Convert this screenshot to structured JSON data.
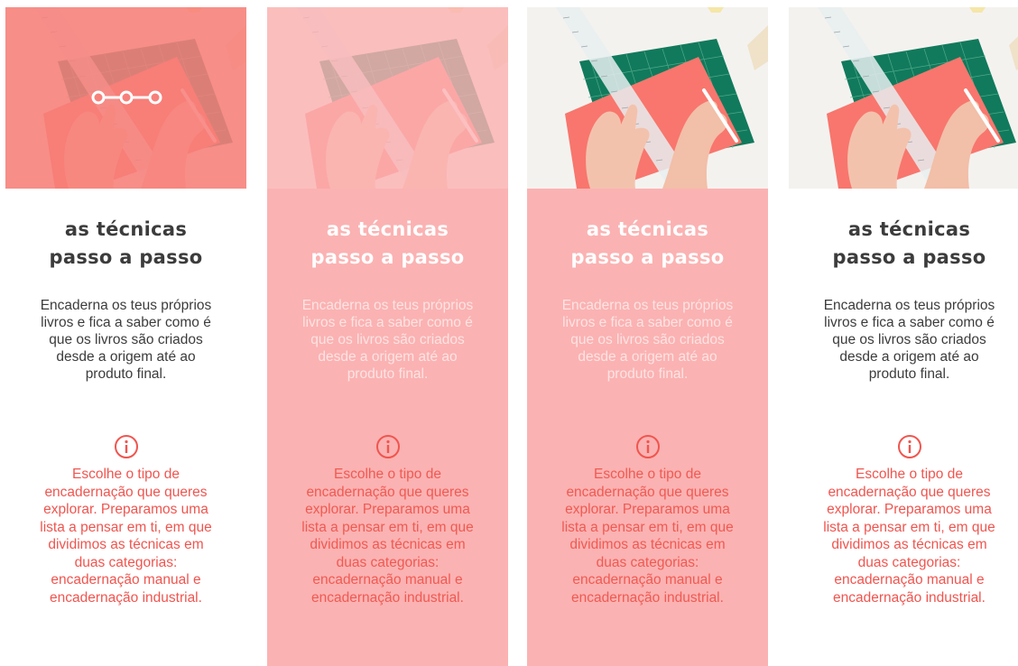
{
  "colors": {
    "accent": "#f0554f",
    "card_pink": "#fbb2b2",
    "overlay_salmon": "#f77f7a",
    "mat_green": "#117a5c",
    "paper_salmon": "#f8766d"
  },
  "cards": [
    {
      "variant": "photo-overlay-slider",
      "title": "as técnicas\npasso a passo",
      "description": "Encaderna os teus próprios\nlivros e fica a saber como é\nque os livros são criados\ndesde a origem até ao\nproduto final.",
      "info_icon": "info-icon",
      "info_text": "Escolhe  o tipo de\nencadernação que queres\nexplorar. Preparamos uma\nlista a pensar em ti, em que\ndividimos as técnicas em\nduas categorias:\nencadernação manual e\nencadernação industrial."
    },
    {
      "variant": "pink-full",
      "title": "as técnicas\npasso a passo",
      "description": "Encaderna os teus próprios\nlivros e fica a saber como é\nque os livros são criados\ndesde a origem até ao\nproduto final.",
      "info_icon": "info-icon",
      "info_text": "Escolhe  o tipo de\nencadernação que queres\nexplorar. Preparamos uma\nlista a pensar em ti, em que\ndividimos as técnicas em\nduas categorias:\nencadernação manual e\nencadernação industrial."
    },
    {
      "variant": "pink-body-color-photo",
      "title": "as técnicas\npasso a passo",
      "description": "Encaderna os teus próprios\nlivros e fica a saber como é\nque os livros são criados\ndesde a origem até ao\nproduto final.",
      "info_icon": "info-icon",
      "info_text": "Escolhe  o tipo de\nencadernação que queres\nexplorar. Preparamos uma\nlista a pensar em ti, em que\ndividimos as técnicas em\nduas categorias:\nencadernação manual e\nencadernação industrial."
    },
    {
      "variant": "white-color-photo",
      "title": "as técnicas\npasso a passo",
      "description": "Encaderna os teus próprios\nlivros e fica a saber como é\nque os livros são criados\ndesde a origem até ao\nproduto final.",
      "info_icon": "info-icon",
      "info_text": "Escolhe  o tipo de\nencadernação que queres\nexplorar. Preparamos uma\nlista a pensar em ti, em que\ndividimos as técnicas em\nduas categorias:\nencadernação manual e\nencadernação industrial."
    }
  ]
}
